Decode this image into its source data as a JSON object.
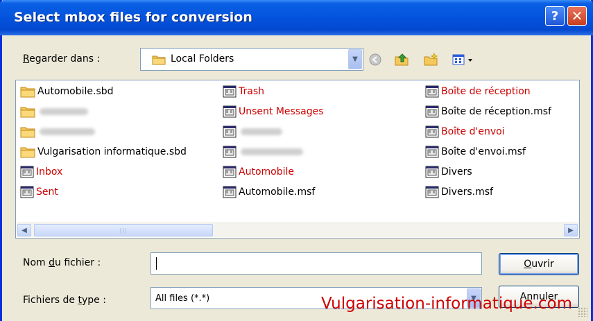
{
  "window": {
    "title": "Select mbox files for conversion",
    "help_label": "?",
    "close_label": "✕"
  },
  "look_in": {
    "label_pre": "",
    "label_key": "R",
    "label_post": "egarder dans :",
    "value": "Local Folders"
  },
  "toolbar": {
    "icons": [
      "back-icon",
      "up-folder-icon",
      "new-folder-icon",
      "view-menu-icon"
    ]
  },
  "files": {
    "columns": [
      [
        {
          "name": "Automobile.sbd",
          "type": "folder",
          "color": "black"
        },
        {
          "name": "",
          "type": "folder",
          "color": "black",
          "blurred": true
        },
        {
          "name": "",
          "type": "folder",
          "color": "black",
          "blurred": true
        },
        {
          "name": "Vulgarisation informatique.sbd",
          "type": "folder",
          "color": "black"
        },
        {
          "name": "Inbox",
          "type": "file",
          "color": "red"
        },
        {
          "name": "Sent",
          "type": "file",
          "color": "red"
        }
      ],
      [
        {
          "name": "Trash",
          "type": "file",
          "color": "red"
        },
        {
          "name": "Unsent Messages",
          "type": "file",
          "color": "red"
        },
        {
          "name": "",
          "type": "file",
          "color": "black",
          "blurred": true
        },
        {
          "name": "",
          "type": "file",
          "color": "black",
          "blurred": true
        },
        {
          "name": "Automobile",
          "type": "file",
          "color": "red"
        },
        {
          "name": "Automobile.msf",
          "type": "file",
          "color": "black"
        }
      ],
      [
        {
          "name": "Boîte de réception",
          "type": "file",
          "color": "red"
        },
        {
          "name": "Boîte de réception.msf",
          "type": "file",
          "color": "black"
        },
        {
          "name": "Boîte d'envoi",
          "type": "file",
          "color": "red"
        },
        {
          "name": "Boîte d'envoi.msf",
          "type": "file",
          "color": "black"
        },
        {
          "name": "Divers",
          "type": "file",
          "color": "black"
        },
        {
          "name": "Divers.msf",
          "type": "file",
          "color": "black"
        }
      ]
    ]
  },
  "filename": {
    "label_pre": "Nom ",
    "label_key": "d",
    "label_post": "u fichier :",
    "value": ""
  },
  "filetype": {
    "label_pre": "Fichiers de ",
    "label_key": "t",
    "label_post": "ype :",
    "value": "All files (*.*)"
  },
  "buttons": {
    "open_key": "O",
    "open_rest": "uvrir",
    "cancel": "Annuler"
  },
  "watermark": "Vulgarisation-informatique.com",
  "colors": {
    "title_blue": "#0453dd",
    "red_text": "#cc0000",
    "dialog_bg": "#ece9d8"
  }
}
